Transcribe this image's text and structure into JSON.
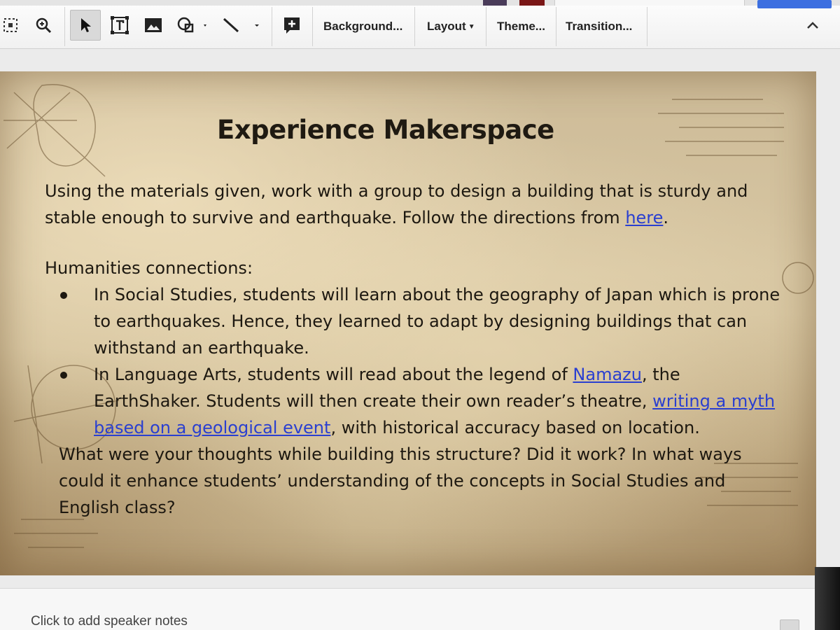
{
  "toolbar": {
    "tools": [
      {
        "icon": "select-frame-icon"
      },
      {
        "icon": "zoom-icon"
      },
      {
        "icon": "pointer-icon",
        "active": true
      },
      {
        "icon": "textbox-icon"
      },
      {
        "icon": "image-icon"
      },
      {
        "icon": "shape-icon"
      },
      {
        "icon": "line-icon"
      },
      {
        "icon": "comment-add-icon"
      }
    ],
    "background_label": "Background...",
    "layout_label": "Layout",
    "theme_label": "Theme...",
    "transition_label": "Transition...",
    "collapse_icon": "chevron-up-icon"
  },
  "slide": {
    "title": "Experience Makerspace",
    "intro_text": "Using the materials given, work with a group to design a building that is sturdy and stable enough to survive and earthquake. Follow the directions from ",
    "intro_link": "here",
    "intro_end": ".",
    "humanities_heading": "Humanities connections:",
    "bullet1": "In Social Studies, students will learn about the geography of Japan which is prone to earthquakes. Hence, they learned to adapt by designing buildings that can withstand an earthquake.",
    "bullet2_part1": "In Language Arts, students will read about the legend of ",
    "bullet2_link1": "Namazu",
    "bullet2_part2": ", the EarthShaker. Students will then create their own reader’s theatre, ",
    "bullet2_link2": "writing a myth based on a geological event",
    "bullet2_part3": ", with historical accuracy based on location.",
    "closing": "What were your thoughts while building this structure? Did it work? In what ways could it enhance students’ understanding of the concepts in Social Studies and English class?",
    "link_color": "#2a3fd0"
  },
  "notes": {
    "placeholder": "Click to add speaker notes"
  }
}
